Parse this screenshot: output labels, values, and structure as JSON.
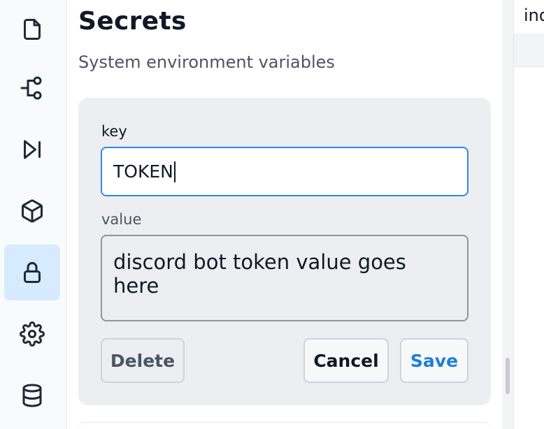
{
  "sidebar": {
    "items": [
      {
        "icon": "file-icon",
        "active": false
      },
      {
        "icon": "git-flow-icon",
        "active": false
      },
      {
        "icon": "skip-forward-icon",
        "active": false
      },
      {
        "icon": "cube-icon",
        "active": false
      },
      {
        "icon": "lock-icon",
        "active": true
      },
      {
        "icon": "gear-icon",
        "active": false
      },
      {
        "icon": "database-icon",
        "active": false
      }
    ]
  },
  "secrets": {
    "title": "Secrets",
    "subtitle": "System environment variables",
    "key_label": "key",
    "key_value": "TOKEN",
    "value_label": "value",
    "value_text": "discord bot token value goes here",
    "delete_label": "Delete",
    "cancel_label": "Cancel",
    "save_label": "Save"
  },
  "right_pane": {
    "partial_text": "ind"
  },
  "colors": {
    "accent": "#2a8be8",
    "save_text": "#1f7fd6",
    "active_nav": "#d6ebff",
    "card_bg": "#eceef2"
  }
}
